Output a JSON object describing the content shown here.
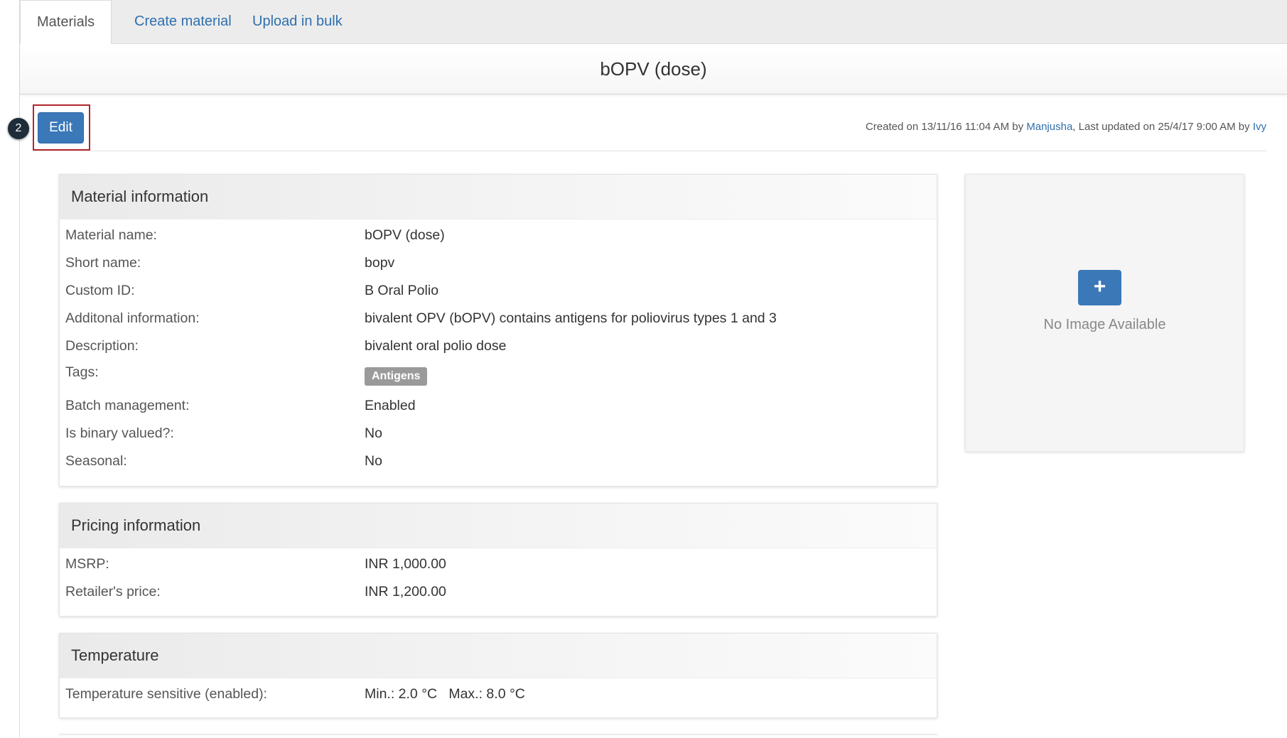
{
  "tabs": [
    {
      "label": "Materials",
      "active": true
    },
    {
      "label": "Create material",
      "active": false
    },
    {
      "label": "Upload in bulk",
      "active": false
    }
  ],
  "page_title": "bOPV (dose)",
  "step_number": "2",
  "edit_label": "Edit",
  "audit": {
    "created_prefix": "Created on 13/11/16 11:04 AM by ",
    "created_by": "Manjusha",
    "updated_prefix": ", Last updated on 25/4/17 9:00 AM by ",
    "updated_by": "Ivy"
  },
  "material_info": {
    "heading": "Material information",
    "rows": [
      {
        "label": "Material name:",
        "value": "bOPV (dose)"
      },
      {
        "label": "Short name:",
        "value": "bopv"
      },
      {
        "label": "Custom ID:",
        "value": "B Oral Polio"
      },
      {
        "label": "Additonal information:",
        "value": "bivalent OPV (bOPV) contains antigens for poliovirus types 1 and 3"
      },
      {
        "label": "Description:",
        "value": "bivalent oral polio dose"
      },
      {
        "label": "Tags:",
        "tag": "Antigens"
      },
      {
        "label": "Batch management:",
        "value": "Enabled"
      },
      {
        "label": "Is binary valued?:",
        "value": "No"
      },
      {
        "label": "Seasonal:",
        "value": "No"
      }
    ]
  },
  "pricing_info": {
    "heading": "Pricing information",
    "rows": [
      {
        "label": "MSRP:",
        "value": "INR 1,000.00"
      },
      {
        "label": "Retailer's price:",
        "value": "INR 1,200.00"
      }
    ]
  },
  "temperature": {
    "heading": "Temperature",
    "rows": [
      {
        "label": "Temperature sensitive (enabled):",
        "value": "Min.: 2.0 °C   Max.: 8.0 °C"
      }
    ]
  },
  "image_panel": {
    "add_icon": "plus-icon",
    "no_image_text": "No Image Available"
  },
  "colors": {
    "primary": "#3a78b8",
    "link": "#2f6fad",
    "highlight": "#b3262c",
    "tag": "#9a9a9a"
  }
}
